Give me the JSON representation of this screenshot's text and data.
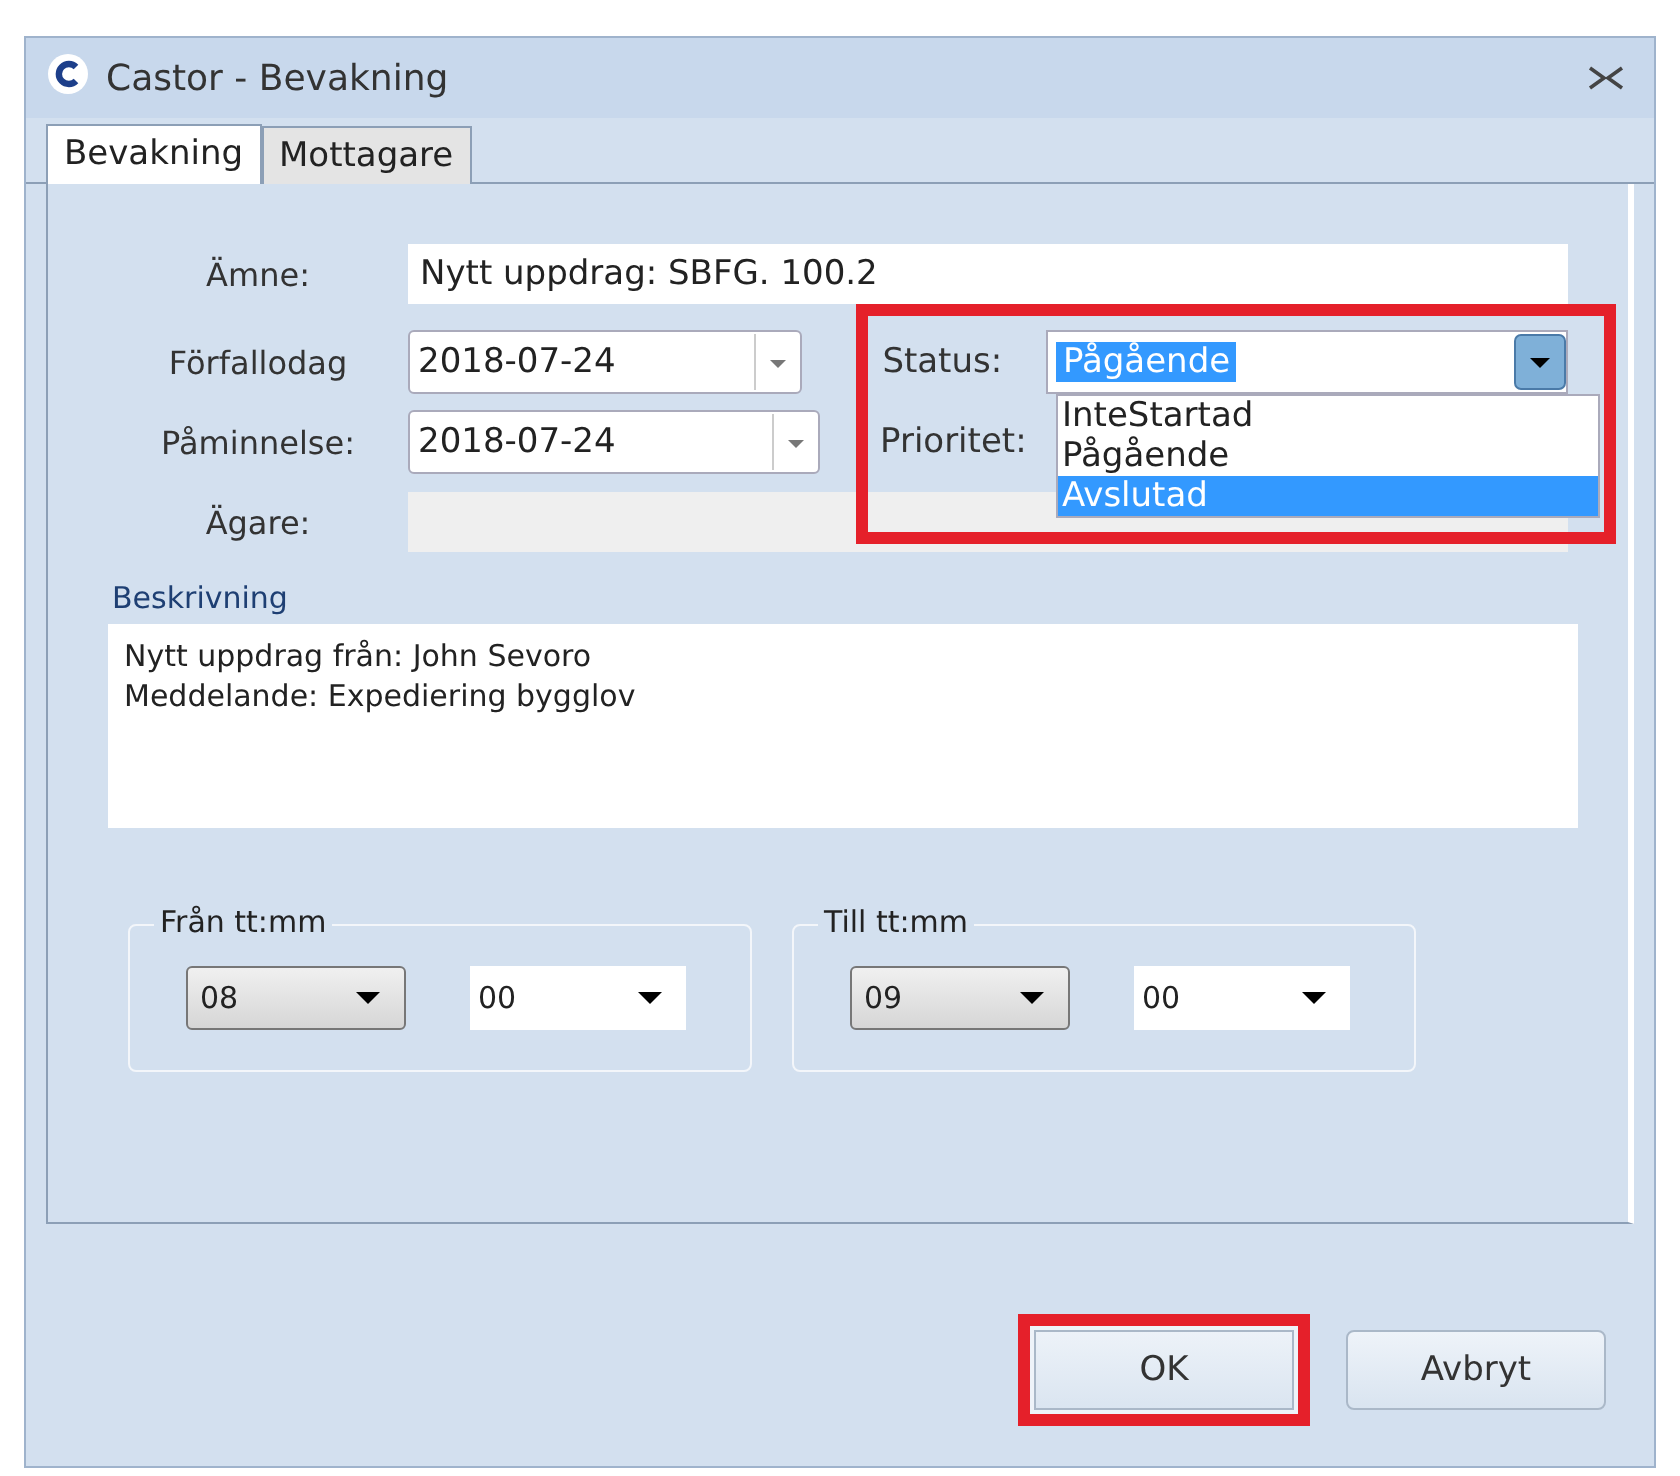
{
  "window": {
    "title": "Castor - Bevakning"
  },
  "tabs": [
    {
      "label": "Bevakning",
      "selected": true
    },
    {
      "label": "Mottagare",
      "selected": false
    }
  ],
  "subject": {
    "label": "Ämne:",
    "value": "Nytt uppdrag: SBFG. 100.2"
  },
  "due_date": {
    "label": "Förfallodag",
    "value": "2018-07-24"
  },
  "reminder": {
    "label": "Påminnelse:",
    "value": "2018-07-24"
  },
  "owner": {
    "label": "Ägare:"
  },
  "status": {
    "label": "Status:",
    "value": "Pågående",
    "expanded": true,
    "highlighted": true,
    "options": [
      {
        "label": "InteStartad",
        "highlighted": false
      },
      {
        "label": "Pågående",
        "highlighted": false
      },
      {
        "label": "Avslutad",
        "highlighted": true
      }
    ]
  },
  "priority": {
    "label": "Prioritet:"
  },
  "description": {
    "label": "Beskrivning",
    "lines": [
      "Nytt uppdrag från: John Sevoro",
      "Meddelande: Expediering bygglov"
    ]
  },
  "time_groups": [
    {
      "legend": "Från tt:mm",
      "hour": "08",
      "minute": "00"
    },
    {
      "legend": "Till tt:mm",
      "hour": "09",
      "minute": "00"
    }
  ],
  "buttons": [
    {
      "label": "OK",
      "highlighted": true
    },
    {
      "label": "Avbryt",
      "highlighted": false
    }
  ]
}
